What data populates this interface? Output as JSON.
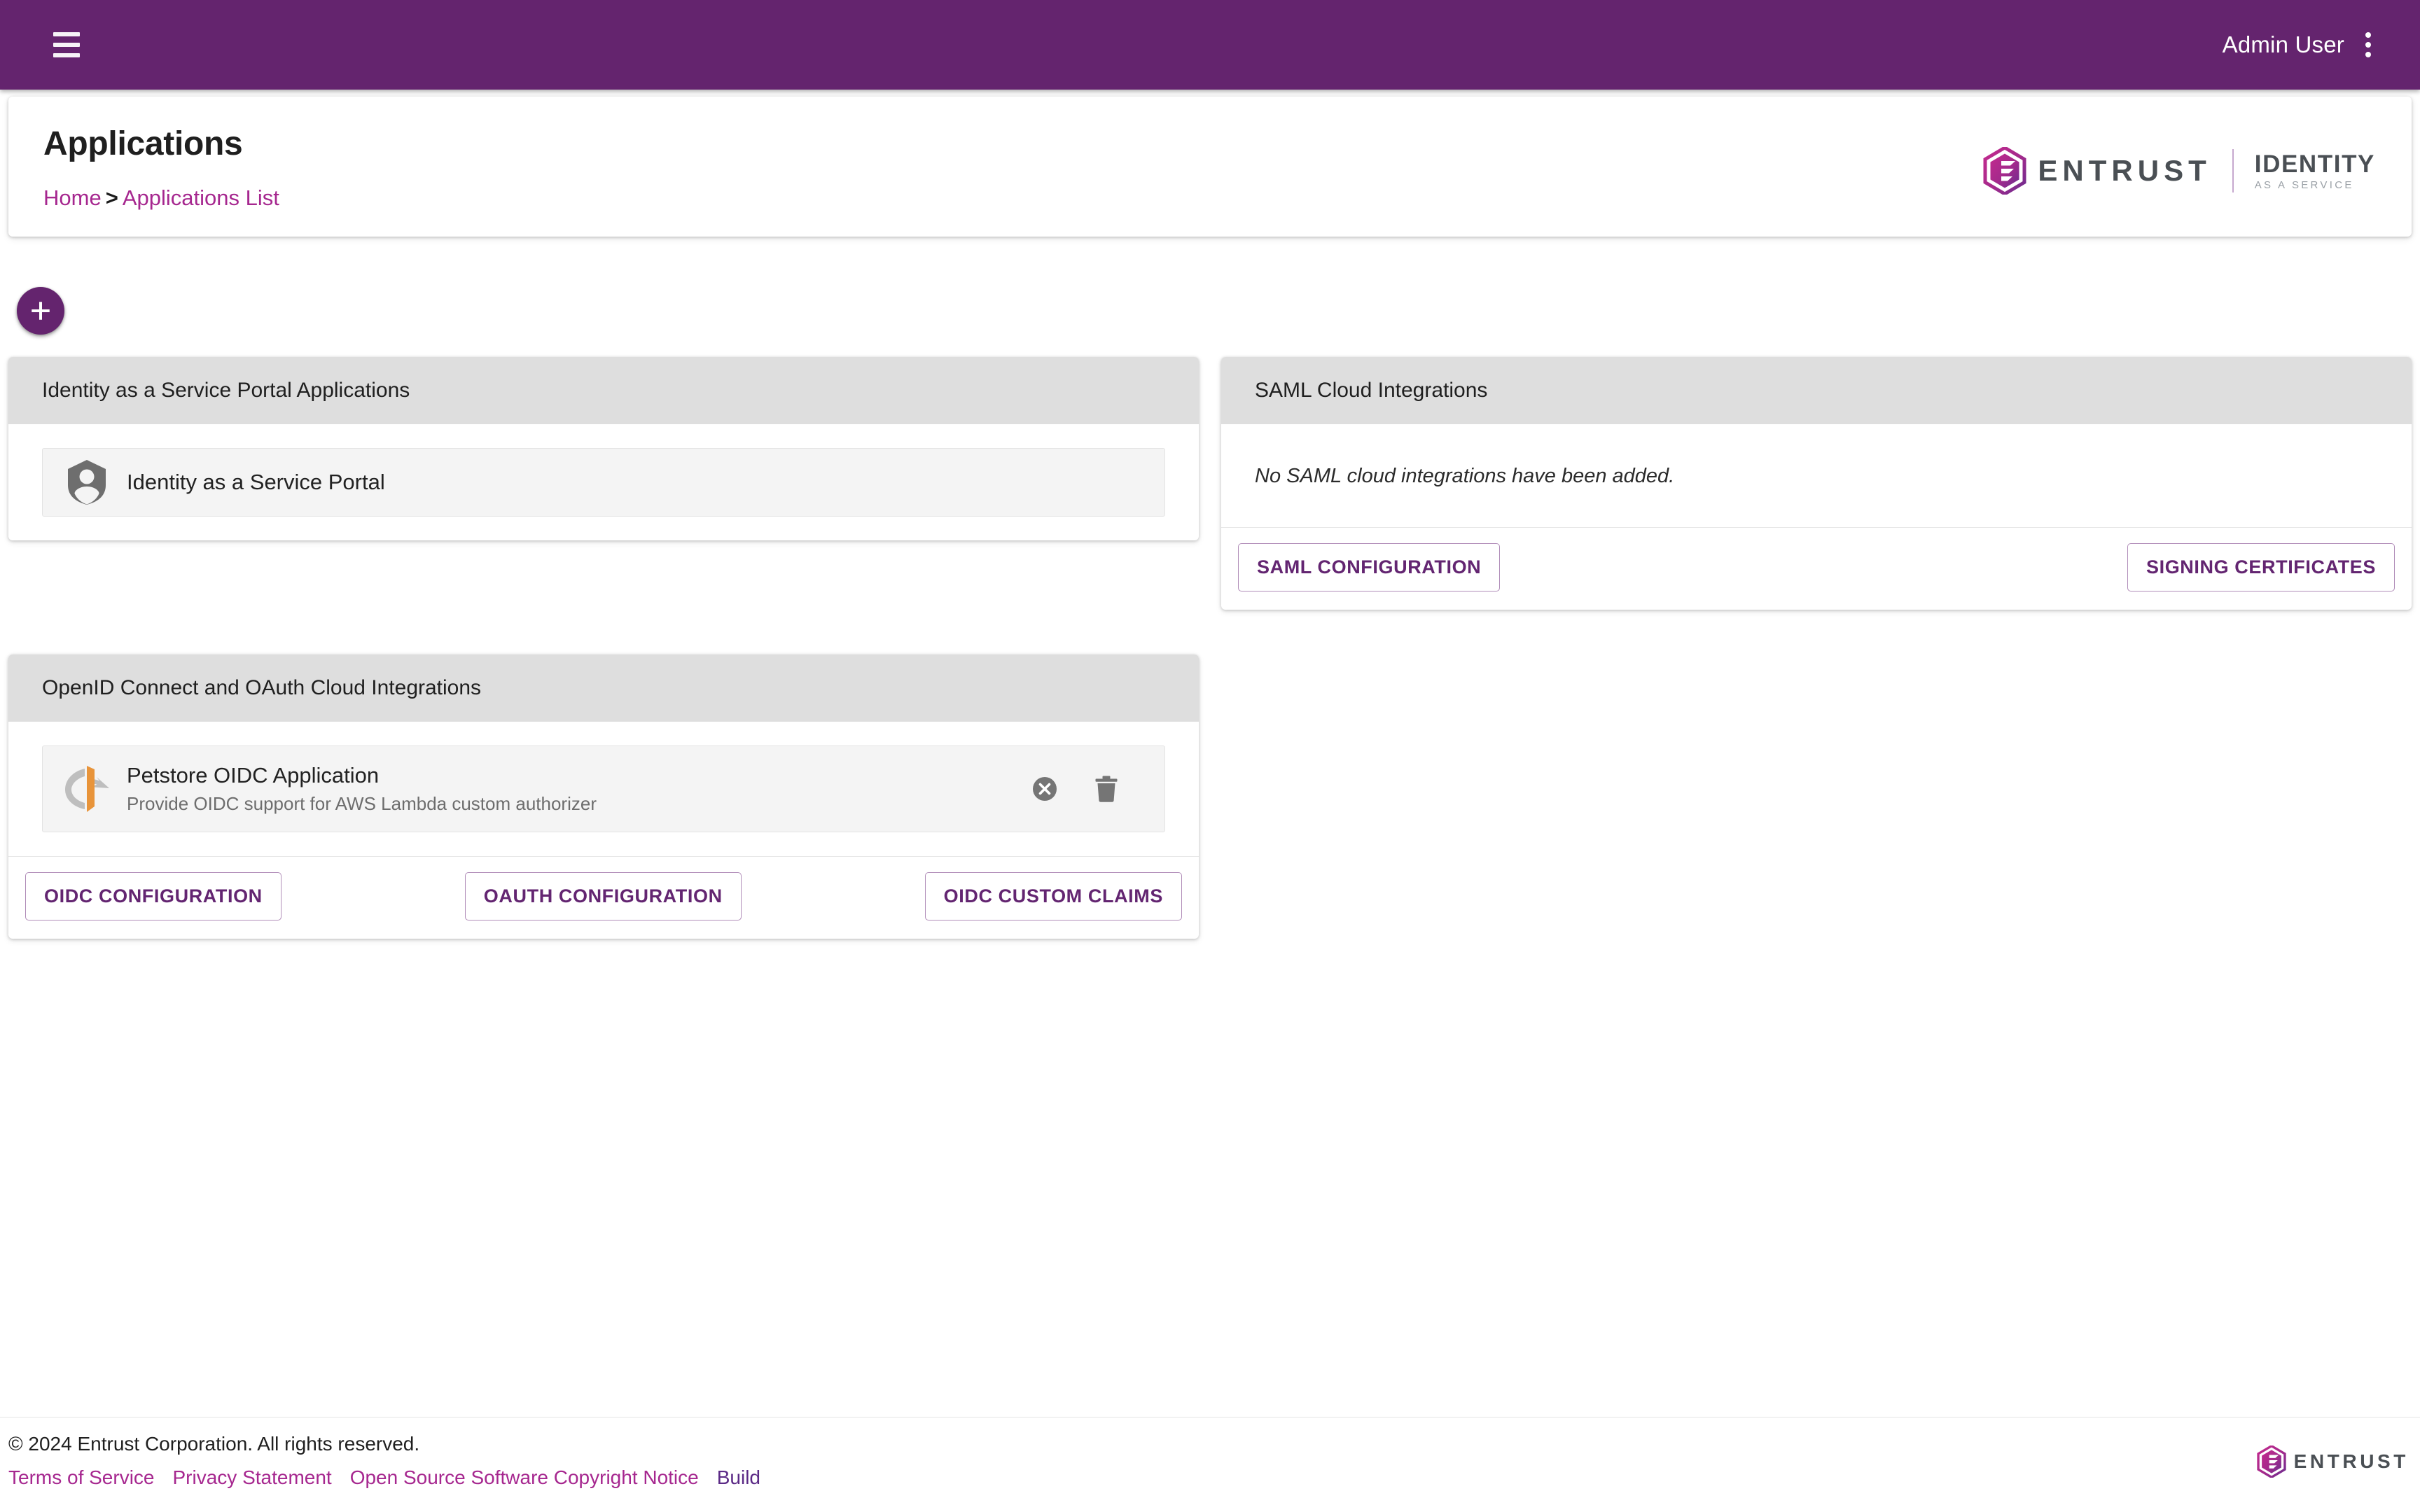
{
  "appbar": {
    "menu_icon": "hamburger-icon",
    "user_name": "Admin User",
    "kebab_icon": "kebab-menu-icon"
  },
  "header": {
    "title": "Applications",
    "breadcrumb": {
      "home": "Home",
      "separator": ">",
      "current": "Applications List"
    },
    "brand": {
      "mark_icon": "entrust-hex-logo",
      "wordmark": "ENTRUST",
      "product_line1": "IDENTITY",
      "product_line2": "AS A SERVICE"
    }
  },
  "add_button": {
    "icon": "plus-icon",
    "label": "+"
  },
  "cards": {
    "portal_apps": {
      "title": "Identity as a Service Portal Applications",
      "rows": [
        {
          "icon": "shield-user-icon",
          "name": "Identity as a Service Portal"
        }
      ]
    },
    "saml": {
      "title": "SAML Cloud Integrations",
      "empty_message": "No SAML cloud integrations have been added.",
      "buttons": [
        {
          "label": "SAML CONFIGURATION"
        },
        {
          "label": "SIGNING CERTIFICATES"
        }
      ]
    },
    "oidc": {
      "title": "OpenID Connect and OAuth Cloud Integrations",
      "rows": [
        {
          "icon": "openid-connect-icon",
          "name": "Petstore OIDC Application",
          "description": "Provide OIDC support for AWS Lambda custom authorizer",
          "actions": [
            {
              "icon": "disable-circle-x-icon"
            },
            {
              "icon": "trash-icon"
            }
          ]
        }
      ],
      "buttons": [
        {
          "label": "OIDC CONFIGURATION"
        },
        {
          "label": "OAUTH CONFIGURATION"
        },
        {
          "label": "OIDC CUSTOM CLAIMS"
        }
      ]
    }
  },
  "footer": {
    "copyright": "© 2024 Entrust Corporation. All rights reserved.",
    "links": [
      {
        "label": "Terms of Service"
      },
      {
        "label": "Privacy Statement"
      },
      {
        "label": "Open Source Software Copyright Notice"
      },
      {
        "label": "Build"
      }
    ],
    "logo": {
      "mark_icon": "entrust-hex-logo",
      "wordmark": "ENTRUST"
    }
  },
  "colors": {
    "brand_purple": "#64246E",
    "link_magenta": "#A6278F",
    "button_purple": "#632571",
    "card_header_grey": "#DEDEDE",
    "row_grey": "#F4F4F4",
    "oidc_orange": "#E8943A",
    "icon_grey": "#6E6E6E"
  }
}
